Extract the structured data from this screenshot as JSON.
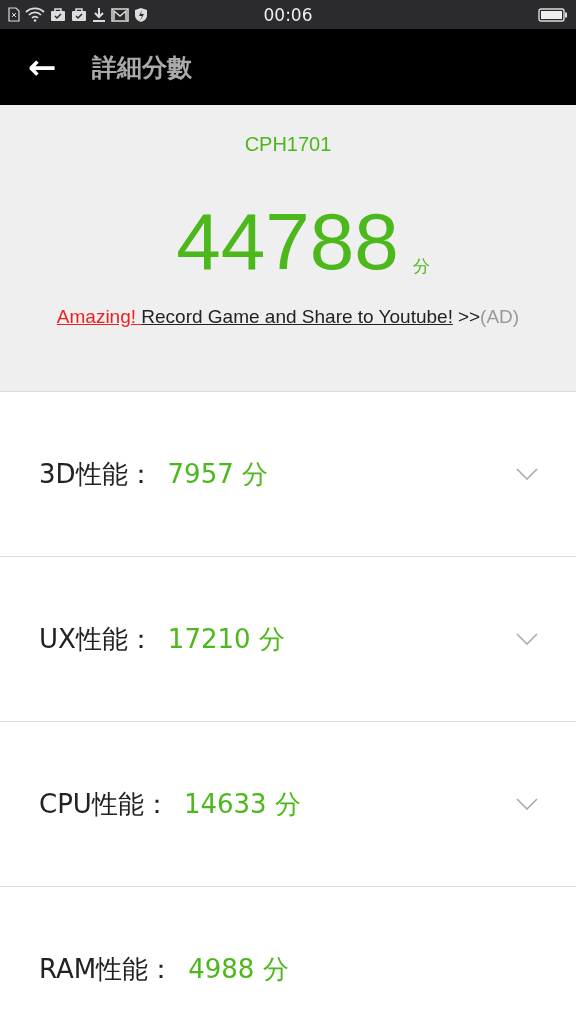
{
  "status_bar": {
    "time": "00:06"
  },
  "app_bar": {
    "back": "←",
    "title": "詳細分數"
  },
  "summary": {
    "device": "CPH1701",
    "score": "44788",
    "unit": "分",
    "ad": {
      "highlight": "Amazing! ",
      "link": "Record Game and Share to Youtube!",
      "arrows": ">>",
      "tag": "(AD)"
    }
  },
  "categories": [
    {
      "label": "3D性能：",
      "score": "7957 分",
      "expandable": true
    },
    {
      "label": "UX性能：",
      "score": "17210 分",
      "expandable": true
    },
    {
      "label": "CPU性能：",
      "score": "14633 分",
      "expandable": true
    },
    {
      "label": "RAM性能：",
      "score": "4988 分",
      "expandable": false
    }
  ]
}
